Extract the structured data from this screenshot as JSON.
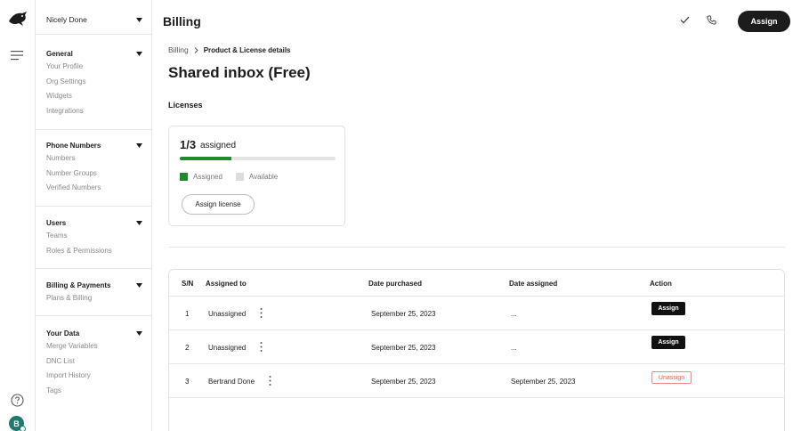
{
  "rail": {
    "logo_icon": "bird-logo-icon",
    "menu_icon": "hamburger-menu-icon",
    "help_icon": "help-circle-icon",
    "avatar_initial": "B"
  },
  "sidebar": {
    "org_name": "Nicely Done",
    "sections": [
      {
        "title": "General",
        "items": [
          "Your Profile",
          "Org Settings",
          "Widgets",
          "Integrations"
        ]
      },
      {
        "title": "Phone Numbers",
        "items": [
          "Numbers",
          "Number Groups",
          "Verified Numbers"
        ]
      },
      {
        "title": "Users",
        "items": [
          "Teams",
          "Roles & Permissions"
        ]
      },
      {
        "title": "Billing & Payments",
        "items": [
          "Plans & Billing"
        ]
      },
      {
        "title": "Your Data",
        "items": [
          "Merge Variables",
          "DNC List",
          "Import History",
          "Tags"
        ]
      }
    ]
  },
  "header": {
    "title": "Billing",
    "assign_label": "Assign"
  },
  "breadcrumb": {
    "parent": "Billing",
    "current": "Product & License details"
  },
  "page": {
    "title": "Shared inbox (Free)",
    "licenses_label": "Licenses"
  },
  "licenses": {
    "count": "1/3",
    "count_label": "assigned",
    "assigned_fraction": 0.333,
    "legend_assigned": "Assigned",
    "legend_available": "Available",
    "assign_button": "Assign license",
    "colors": {
      "assigned": "#1f8a2e",
      "available": "#dcdcdc"
    }
  },
  "table": {
    "columns": [
      "S/N",
      "Assigned to",
      "Date purchased",
      "Date assigned",
      "Action"
    ],
    "rows": [
      {
        "sn": "1",
        "assigned_to": "Unassigned",
        "date_purchased": "September 25, 2023",
        "date_assigned": "...",
        "action": "Assign"
      },
      {
        "sn": "2",
        "assigned_to": "Unassigned",
        "date_purchased": "September 25, 2023",
        "date_assigned": "...",
        "action": "Assign"
      },
      {
        "sn": "3",
        "assigned_to": "Bertrand Done",
        "date_purchased": "September 25, 2023",
        "date_assigned": "September 25, 2023",
        "action": "Unassign"
      }
    ]
  }
}
